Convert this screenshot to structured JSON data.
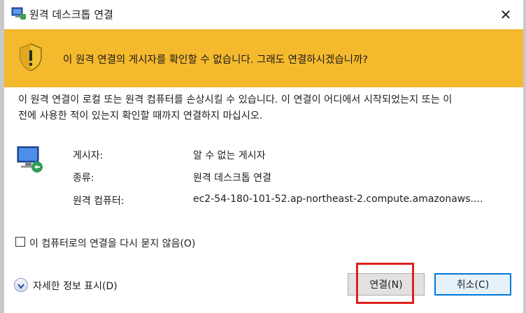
{
  "window": {
    "title": "원격 데스크톱 연결"
  },
  "banner": {
    "text": "이 원격 연결의 게시자를 확인할 수 없습니다. 그래도 연결하시겠습니까?",
    "color": "#f5b92e"
  },
  "description": {
    "line1": "이 원격 연결이 로컬 또는 원격 컴퓨터를 손상시킬 수 있습니다. 이 연결이 어디에서 시작되었는지 또는 이",
    "line2": "전에 사용한 적이 있는지 확인할 때까지 연결하지 마십시오."
  },
  "info": [
    {
      "label": "게시자:",
      "value": "알 수 없는 게시자"
    },
    {
      "label": "종류:",
      "value": "원격 데스크톱 연결"
    },
    {
      "label": "원격 컴퓨터:",
      "value": "ec2-54-180-101-52.ap-northeast-2.compute.amazonaws...."
    }
  ],
  "checkbox": {
    "label": "이 컴퓨터로의 연결을 다시 묻지 않음(O)",
    "checked": false
  },
  "details": {
    "label": "자세한 정보 표시(D)"
  },
  "buttons": {
    "connect": "연결(N)",
    "cancel": "취소(C)"
  },
  "highlight": {
    "color": "#e0201c"
  }
}
